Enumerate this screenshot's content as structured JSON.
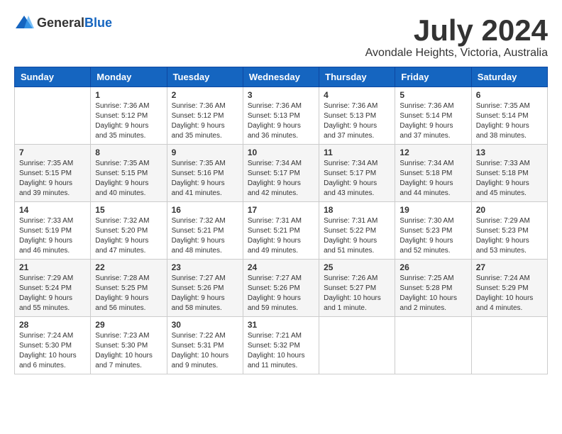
{
  "logo": {
    "general": "General",
    "blue": "Blue"
  },
  "title": "July 2024",
  "subtitle": "Avondale Heights, Victoria, Australia",
  "weekdays": [
    "Sunday",
    "Monday",
    "Tuesday",
    "Wednesday",
    "Thursday",
    "Friday",
    "Saturday"
  ],
  "weeks": [
    [
      {
        "day": "",
        "info": ""
      },
      {
        "day": "1",
        "info": "Sunrise: 7:36 AM\nSunset: 5:12 PM\nDaylight: 9 hours\nand 35 minutes."
      },
      {
        "day": "2",
        "info": "Sunrise: 7:36 AM\nSunset: 5:12 PM\nDaylight: 9 hours\nand 35 minutes."
      },
      {
        "day": "3",
        "info": "Sunrise: 7:36 AM\nSunset: 5:13 PM\nDaylight: 9 hours\nand 36 minutes."
      },
      {
        "day": "4",
        "info": "Sunrise: 7:36 AM\nSunset: 5:13 PM\nDaylight: 9 hours\nand 37 minutes."
      },
      {
        "day": "5",
        "info": "Sunrise: 7:36 AM\nSunset: 5:14 PM\nDaylight: 9 hours\nand 37 minutes."
      },
      {
        "day": "6",
        "info": "Sunrise: 7:35 AM\nSunset: 5:14 PM\nDaylight: 9 hours\nand 38 minutes."
      }
    ],
    [
      {
        "day": "7",
        "info": "Sunrise: 7:35 AM\nSunset: 5:15 PM\nDaylight: 9 hours\nand 39 minutes."
      },
      {
        "day": "8",
        "info": "Sunrise: 7:35 AM\nSunset: 5:15 PM\nDaylight: 9 hours\nand 40 minutes."
      },
      {
        "day": "9",
        "info": "Sunrise: 7:35 AM\nSunset: 5:16 PM\nDaylight: 9 hours\nand 41 minutes."
      },
      {
        "day": "10",
        "info": "Sunrise: 7:34 AM\nSunset: 5:17 PM\nDaylight: 9 hours\nand 42 minutes."
      },
      {
        "day": "11",
        "info": "Sunrise: 7:34 AM\nSunset: 5:17 PM\nDaylight: 9 hours\nand 43 minutes."
      },
      {
        "day": "12",
        "info": "Sunrise: 7:34 AM\nSunset: 5:18 PM\nDaylight: 9 hours\nand 44 minutes."
      },
      {
        "day": "13",
        "info": "Sunrise: 7:33 AM\nSunset: 5:18 PM\nDaylight: 9 hours\nand 45 minutes."
      }
    ],
    [
      {
        "day": "14",
        "info": "Sunrise: 7:33 AM\nSunset: 5:19 PM\nDaylight: 9 hours\nand 46 minutes."
      },
      {
        "day": "15",
        "info": "Sunrise: 7:32 AM\nSunset: 5:20 PM\nDaylight: 9 hours\nand 47 minutes."
      },
      {
        "day": "16",
        "info": "Sunrise: 7:32 AM\nSunset: 5:21 PM\nDaylight: 9 hours\nand 48 minutes."
      },
      {
        "day": "17",
        "info": "Sunrise: 7:31 AM\nSunset: 5:21 PM\nDaylight: 9 hours\nand 49 minutes."
      },
      {
        "day": "18",
        "info": "Sunrise: 7:31 AM\nSunset: 5:22 PM\nDaylight: 9 hours\nand 51 minutes."
      },
      {
        "day": "19",
        "info": "Sunrise: 7:30 AM\nSunset: 5:23 PM\nDaylight: 9 hours\nand 52 minutes."
      },
      {
        "day": "20",
        "info": "Sunrise: 7:29 AM\nSunset: 5:23 PM\nDaylight: 9 hours\nand 53 minutes."
      }
    ],
    [
      {
        "day": "21",
        "info": "Sunrise: 7:29 AM\nSunset: 5:24 PM\nDaylight: 9 hours\nand 55 minutes."
      },
      {
        "day": "22",
        "info": "Sunrise: 7:28 AM\nSunset: 5:25 PM\nDaylight: 9 hours\nand 56 minutes."
      },
      {
        "day": "23",
        "info": "Sunrise: 7:27 AM\nSunset: 5:26 PM\nDaylight: 9 hours\nand 58 minutes."
      },
      {
        "day": "24",
        "info": "Sunrise: 7:27 AM\nSunset: 5:26 PM\nDaylight: 9 hours\nand 59 minutes."
      },
      {
        "day": "25",
        "info": "Sunrise: 7:26 AM\nSunset: 5:27 PM\nDaylight: 10 hours\nand 1 minute."
      },
      {
        "day": "26",
        "info": "Sunrise: 7:25 AM\nSunset: 5:28 PM\nDaylight: 10 hours\nand 2 minutes."
      },
      {
        "day": "27",
        "info": "Sunrise: 7:24 AM\nSunset: 5:29 PM\nDaylight: 10 hours\nand 4 minutes."
      }
    ],
    [
      {
        "day": "28",
        "info": "Sunrise: 7:24 AM\nSunset: 5:30 PM\nDaylight: 10 hours\nand 6 minutes."
      },
      {
        "day": "29",
        "info": "Sunrise: 7:23 AM\nSunset: 5:30 PM\nDaylight: 10 hours\nand 7 minutes."
      },
      {
        "day": "30",
        "info": "Sunrise: 7:22 AM\nSunset: 5:31 PM\nDaylight: 10 hours\nand 9 minutes."
      },
      {
        "day": "31",
        "info": "Sunrise: 7:21 AM\nSunset: 5:32 PM\nDaylight: 10 hours\nand 11 minutes."
      },
      {
        "day": "",
        "info": ""
      },
      {
        "day": "",
        "info": ""
      },
      {
        "day": "",
        "info": ""
      }
    ]
  ]
}
